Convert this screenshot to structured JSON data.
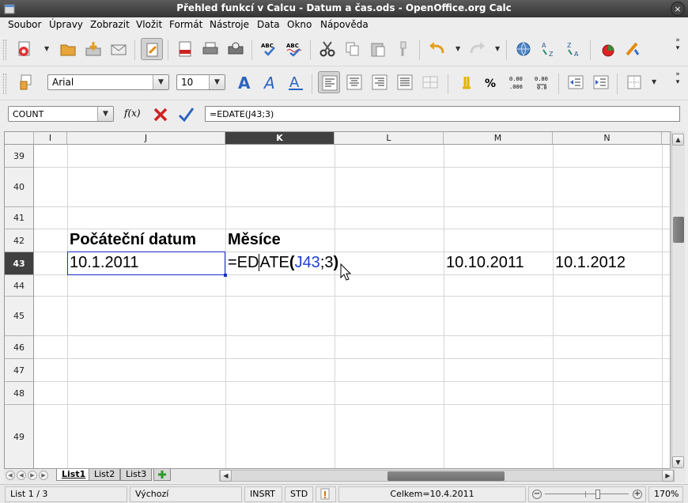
{
  "window": {
    "title": "Přehled funkcí v Calcu - Datum a čas.ods - OpenOffice.org Calc",
    "close_glyph": "×"
  },
  "menu": [
    "Soubor",
    "Úpravy",
    "Zobrazit",
    "Vložit",
    "Formát",
    "Nástroje",
    "Data",
    "Okno",
    "Nápověda"
  ],
  "toolbar2": {
    "font_name": "Arial",
    "font_size": "10"
  },
  "formula_bar": {
    "name_box": "COUNT",
    "fx_label": "f(x)",
    "formula": "=EDATE(J43;3)"
  },
  "columns": [
    "I",
    "J",
    "K",
    "L",
    "M",
    "N"
  ],
  "selected_column": "K",
  "rows": [
    "39",
    "40",
    "41",
    "42",
    "43",
    "44",
    "45",
    "46",
    "47",
    "48",
    "49"
  ],
  "selected_row": "43",
  "cells": {
    "J42": "Počáteční datum",
    "K42": "Měsíce",
    "J43": "10.1.2011",
    "K43_pre": "=ED",
    "K43_fn": "ATE",
    "K43_open": "(",
    "K43_ref": "J43",
    "K43_rest": ";3",
    "K43_close": ")",
    "M43": "10.10.2011",
    "N43": "10.1.2012"
  },
  "sheets": [
    "List1",
    "List2",
    "List3"
  ],
  "active_sheet": "List1",
  "status": {
    "sheet": "List 1 / 3",
    "style": "Výchozí",
    "mode": "INSRT",
    "selection": "STD",
    "sum": "Celkem=10.4.2011",
    "zoom": "170%"
  },
  "colors": {
    "title_bar": "#3c3c3c",
    "cell_reference": "#1f3fd0",
    "cursor": "#1a2fc8",
    "selected_header": "#404040"
  }
}
